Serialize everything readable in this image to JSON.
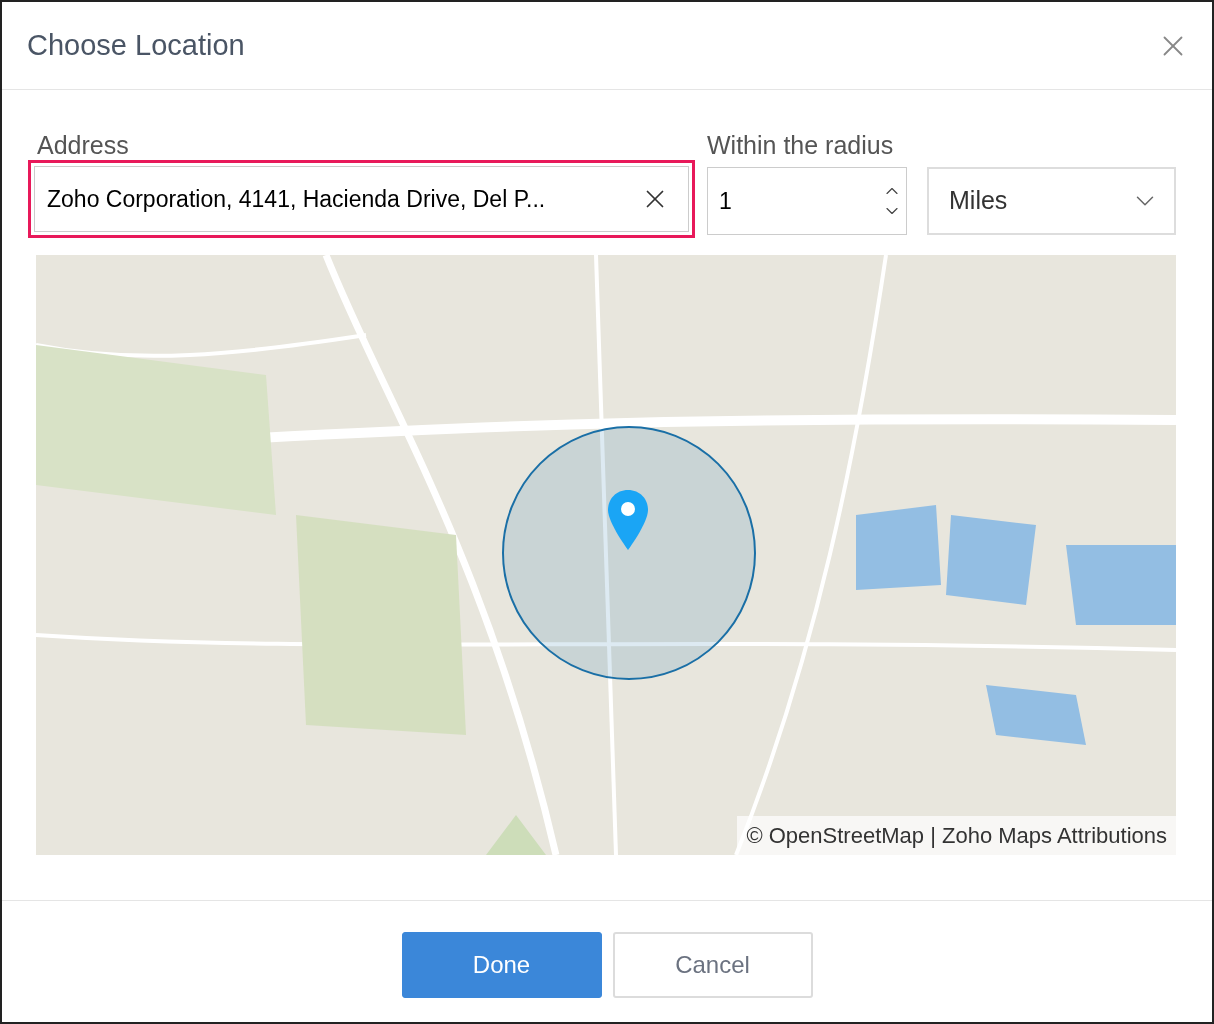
{
  "dialog": {
    "title": "Choose Location"
  },
  "address": {
    "label": "Address",
    "value": "Zoho Corporation, 4141, Hacienda Drive, Del P...",
    "highlighted": true
  },
  "radius": {
    "label": "Within the radius",
    "value": "1",
    "unit": "Miles"
  },
  "map": {
    "attribution": "© OpenStreetMap | Zoho Maps Attributions"
  },
  "buttons": [
    {
      "label": "Done",
      "kind": "primary"
    },
    {
      "label": "Cancel",
      "kind": "secondary"
    }
  ]
}
